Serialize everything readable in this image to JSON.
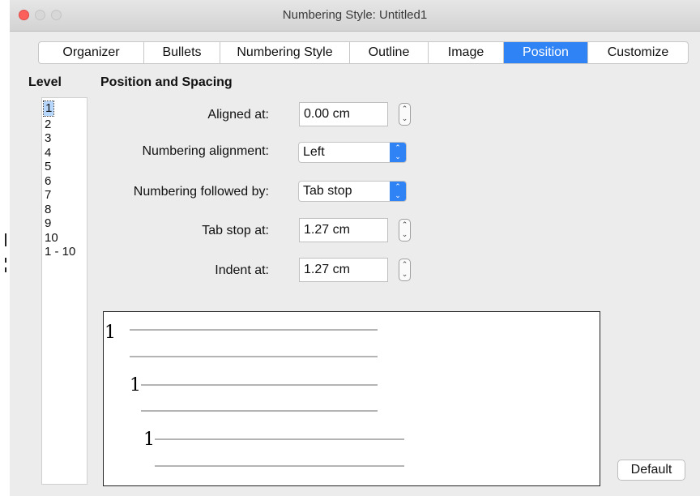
{
  "window": {
    "title": "Numbering Style: Untitled1"
  },
  "tabs": [
    {
      "label": "Organizer",
      "active": false
    },
    {
      "label": "Bullets",
      "active": false
    },
    {
      "label": "Numbering Style",
      "active": false
    },
    {
      "label": "Outline",
      "active": false
    },
    {
      "label": "Image",
      "active": false
    },
    {
      "label": "Position",
      "active": true
    },
    {
      "label": "Customize",
      "active": false
    }
  ],
  "level": {
    "title": "Level",
    "items": [
      "1",
      "2",
      "3",
      "4",
      "5",
      "6",
      "7",
      "8",
      "9",
      "10",
      "1 - 10"
    ],
    "selected": "1"
  },
  "position": {
    "title": "Position and Spacing",
    "aligned_at": {
      "label": "Aligned at:",
      "value": "0.00 cm"
    },
    "numbering_alignment": {
      "label": "Numbering alignment:",
      "value": "Left"
    },
    "numbering_followed_by": {
      "label": "Numbering followed by:",
      "value": "Tab stop"
    },
    "tab_stop_at": {
      "label": "Tab stop at:",
      "value": "1.27 cm"
    },
    "indent_at": {
      "label": "Indent at:",
      "value": "1.27 cm"
    }
  },
  "preview": {
    "numbers": [
      "1",
      "1",
      "1"
    ]
  },
  "buttons": {
    "default": "Default"
  },
  "icons": {
    "spinner": "stepper-icon",
    "dropdown": "chevron-updown-icon"
  },
  "colors": {
    "accent": "#2f83f5",
    "selection": "#b7d6fb",
    "close_button": "#fc605c"
  }
}
